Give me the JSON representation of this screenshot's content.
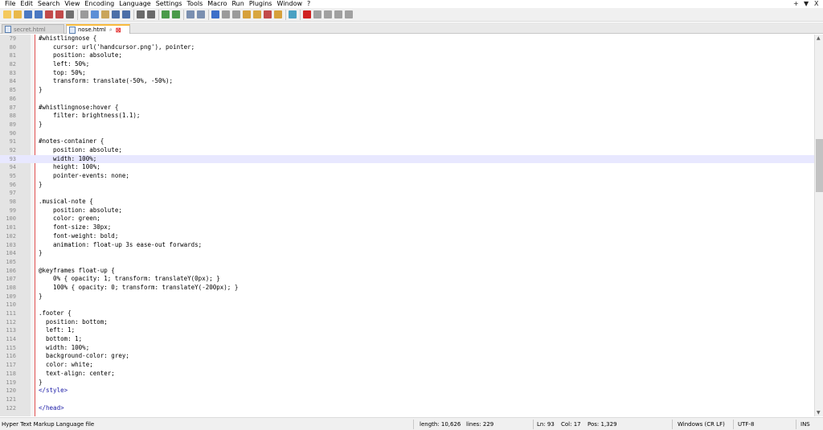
{
  "menubar": {
    "items": [
      "File",
      "Edit",
      "Search",
      "View",
      "Encoding",
      "Language",
      "Settings",
      "Tools",
      "Macro",
      "Run",
      "Plugins",
      "Window",
      "?"
    ],
    "right_controls": [
      "+",
      "▼",
      "X"
    ]
  },
  "toolbar": {
    "icons": [
      "new-file-icon",
      "open-file-icon",
      "save-icon",
      "save-all-icon",
      "close-icon",
      "close-all-icon",
      "print-icon",
      "cut-icon",
      "copy-icon",
      "paste-icon",
      "undo-icon",
      "redo-icon",
      "find-icon",
      "replace-icon",
      "zoom-in-icon",
      "zoom-out-icon",
      "sync-scroll-v-icon",
      "sync-scroll-h-icon",
      "word-wrap-icon",
      "show-all-chars-icon",
      "indent-guide-icon",
      "udl-icon",
      "doc-map-icon",
      "function-list-icon",
      "folder-workspace-icon",
      "monitoring-icon",
      "record-macro-icon",
      "stop-record-icon",
      "play-macro-icon",
      "run-macro-multiple-icon",
      "save-macro-icon"
    ]
  },
  "tabs": [
    {
      "label": "secret.html",
      "active": false
    },
    {
      "label": "nose.html",
      "active": true
    }
  ],
  "editor": {
    "current_line": 93,
    "lines": [
      {
        "n": "79",
        "text": "#whistlingnose {"
      },
      {
        "n": "80",
        "text": "    cursor: url('handcursor.png'), pointer;"
      },
      {
        "n": "81",
        "text": "    position: absolute;"
      },
      {
        "n": "82",
        "text": "    left: 50%;"
      },
      {
        "n": "83",
        "text": "    top: 50%;"
      },
      {
        "n": "84",
        "text": "    transform: translate(-50%, -50%);"
      },
      {
        "n": "85",
        "text": "}"
      },
      {
        "n": "86",
        "text": ""
      },
      {
        "n": "87",
        "text": "#whistlingnose:hover {"
      },
      {
        "n": "88",
        "text": "    filter: brightness(1.1);"
      },
      {
        "n": "89",
        "text": "}"
      },
      {
        "n": "90",
        "text": ""
      },
      {
        "n": "91",
        "text": "#notes-container {"
      },
      {
        "n": "92",
        "text": "    position: absolute;"
      },
      {
        "n": "93",
        "text": "    width: 100%;"
      },
      {
        "n": "94",
        "text": "    height: 100%;"
      },
      {
        "n": "95",
        "text": "    pointer-events: none;"
      },
      {
        "n": "96",
        "text": "}"
      },
      {
        "n": "97",
        "text": ""
      },
      {
        "n": "98",
        "text": ".musical-note {"
      },
      {
        "n": "99",
        "text": "    position: absolute;"
      },
      {
        "n": "100",
        "text": "    color: green;"
      },
      {
        "n": "101",
        "text": "    font-size: 30px;"
      },
      {
        "n": "102",
        "text": "    font-weight: bold;"
      },
      {
        "n": "103",
        "text": "    animation: float-up 3s ease-out forwards;"
      },
      {
        "n": "104",
        "text": "}"
      },
      {
        "n": "105",
        "text": ""
      },
      {
        "n": "106",
        "text": "@keyframes float-up {"
      },
      {
        "n": "107",
        "text": "    0% { opacity: 1; transform: translateY(0px); }"
      },
      {
        "n": "108",
        "text": "    100% { opacity: 0; transform: translateY(-200px); }"
      },
      {
        "n": "109",
        "text": "}"
      },
      {
        "n": "110",
        "text": ""
      },
      {
        "n": "111",
        "text": ".footer {"
      },
      {
        "n": "112",
        "text": "  position: bottom;"
      },
      {
        "n": "113",
        "text": "  left: 1;"
      },
      {
        "n": "114",
        "text": "  bottom: 1;"
      },
      {
        "n": "115",
        "text": "  width: 100%;"
      },
      {
        "n": "116",
        "text": "  background-color: grey;"
      },
      {
        "n": "117",
        "text": "  color: white;"
      },
      {
        "n": "118",
        "text": "  text-align: center;"
      },
      {
        "n": "119",
        "text": "}"
      },
      {
        "n": "120",
        "text": "</style>"
      },
      {
        "n": "121",
        "text": ""
      },
      {
        "n": "122",
        "text": "</head>"
      }
    ]
  },
  "statusbar": {
    "file_type": "Hyper Text Markup Language file",
    "length": "length: 10,626",
    "lines": "lines: 229",
    "ln": "Ln: 93",
    "col": "Col: 17",
    "pos": "Pos: 1,329",
    "eol": "Windows (CR LF)",
    "encoding": "UTF-8",
    "mode": "INS"
  },
  "colors": {
    "current_line": "#e8e8ff",
    "gutter": "#e4e4e4",
    "active_tab_accent": "#f7b93c",
    "fold_margin_border": "#e05050",
    "tag_text": "#1a1aa6"
  }
}
